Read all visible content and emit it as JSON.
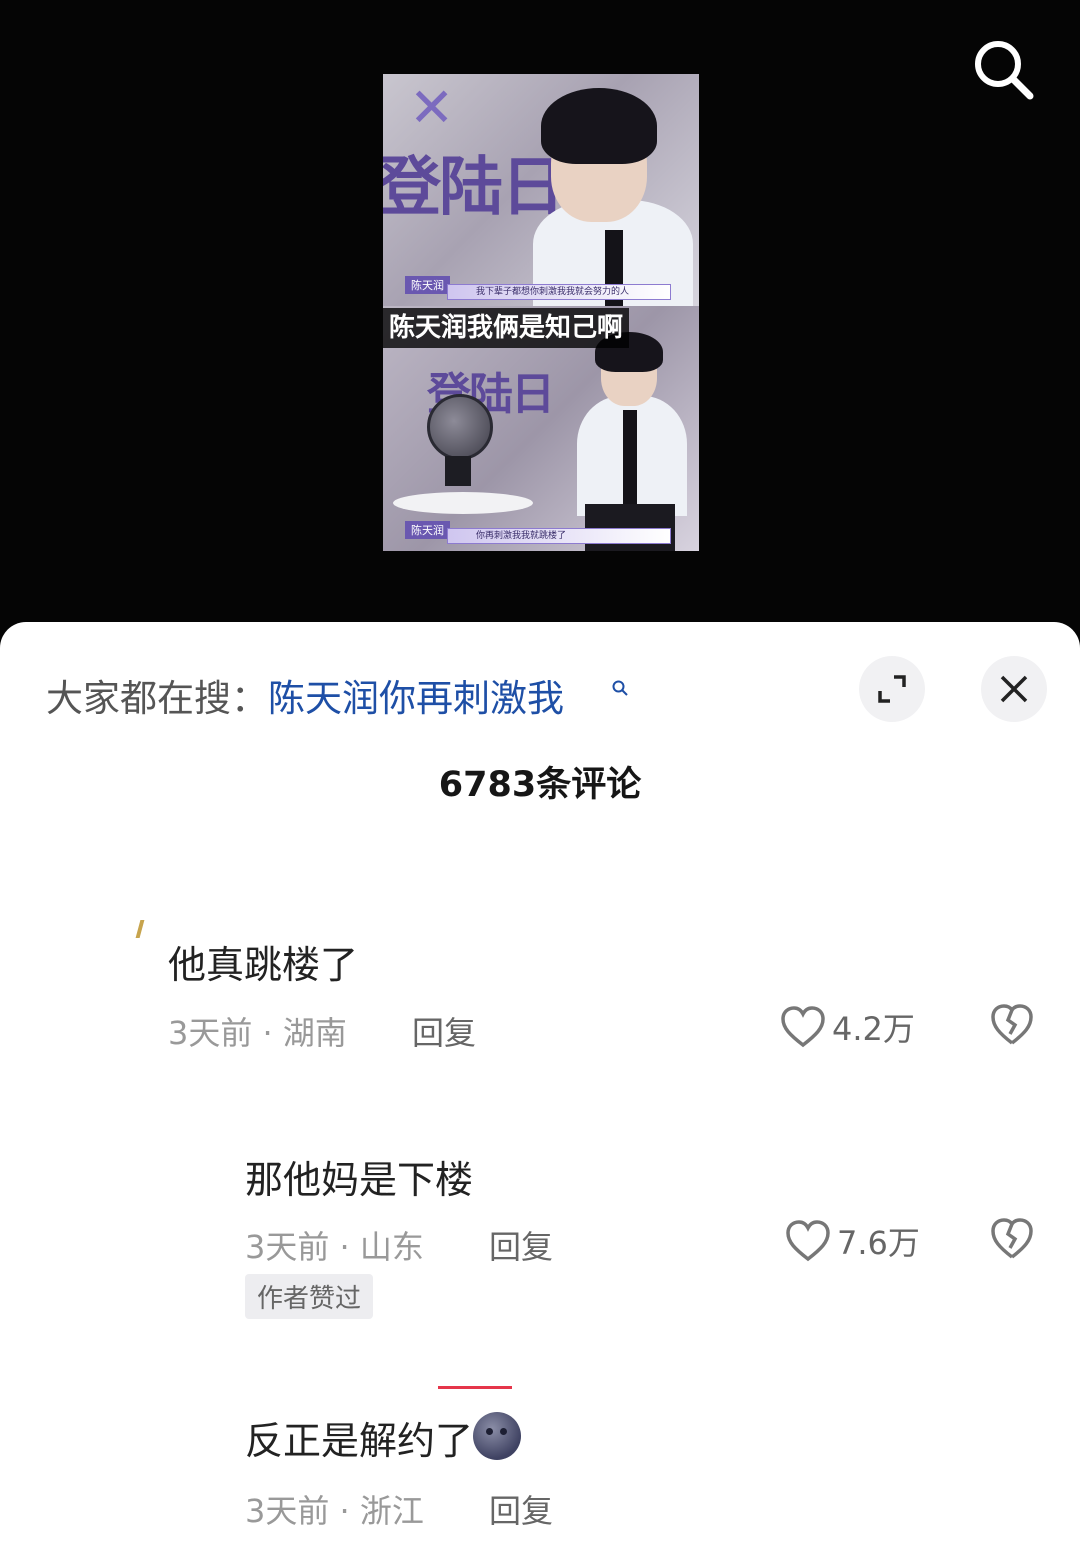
{
  "video": {
    "show_logo": "登陆日",
    "top_frame": {
      "name_tag": "陈天润",
      "subtitle": "我下辈子都想你刺激我我就会努力的人"
    },
    "bottom_frame": {
      "name_tag": "陈天润",
      "subtitle": "你再刺激我我就跳楼了"
    },
    "caption": "陈天润我俩是知己啊",
    "icons": {
      "search": "search-icon"
    }
  },
  "panel": {
    "search_hint_prefix": "大家都在搜：",
    "search_hint_query": "陈天润你再刺激我",
    "comment_count": "6783条评论",
    "icons": {
      "expand": "expand-icon",
      "close": "close-icon"
    }
  },
  "comments": [
    {
      "text": "他真跳楼了",
      "time": "3天前",
      "location": "湖南",
      "reply": "回复",
      "likes": "4.2万"
    },
    {
      "text": "那他妈是下楼",
      "time": "3天前",
      "location": "山东",
      "reply": "回复",
      "likes": "7.6万",
      "badge": "作者赞过"
    },
    {
      "text": "反正是解约了",
      "time": "3天前",
      "location": "浙江",
      "reply": "回复"
    }
  ],
  "colors": {
    "link": "#1e4fa6",
    "accent_red": "#e5354a",
    "show_purple": "#5d4a9a"
  }
}
